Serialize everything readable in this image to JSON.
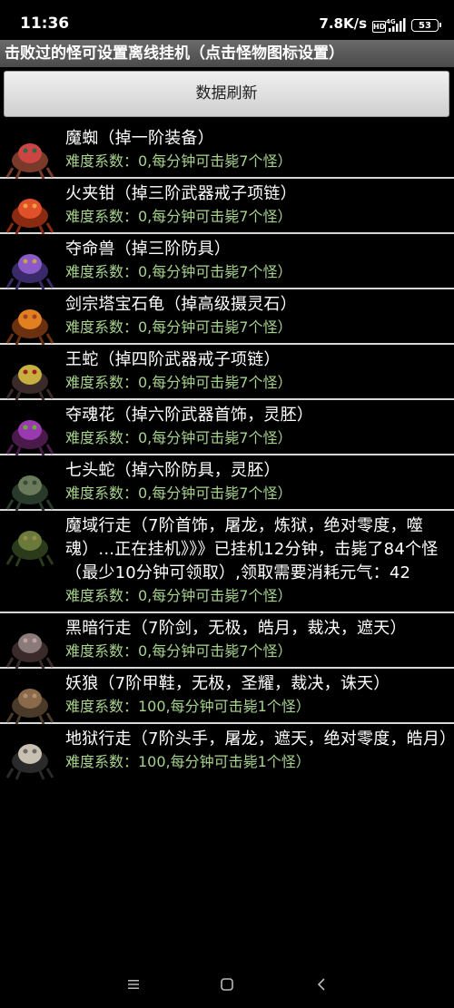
{
  "status": {
    "time": "11:36",
    "speed": "7.8K/s",
    "hd": "HD",
    "network": "4G",
    "battery": "53"
  },
  "title": "击败过的怪可设置离线挂机（点击怪物图标设置）",
  "refresh_label": "数据刷新",
  "monsters": [
    {
      "name": "魔蜘（掉一阶装备）",
      "difficulty": "难度系数：0,每分钟可击毙7个怪）",
      "icon": "spider-monster-icon"
    },
    {
      "name": "火夹钳（掉三阶武器戒子项链）",
      "difficulty": "难度系数：0,每分钟可击毙7个怪）",
      "icon": "fire-crab-icon"
    },
    {
      "name": "夺命兽（掉三阶防具）",
      "difficulty": "难度系数：0,每分钟可击毙7个怪）",
      "icon": "beast-monster-icon"
    },
    {
      "name": "剑宗塔宝石龟（掉高级摄灵石）",
      "difficulty": "难度系数：0,每分钟可击毙7个怪）",
      "icon": "gem-turtle-icon"
    },
    {
      "name": "王蛇（掉四阶武器戒子项链）",
      "difficulty": "难度系数：0,每分钟可击毙7个怪）",
      "icon": "king-snake-icon"
    },
    {
      "name": "夺魂花（掉六阶武器首饰，灵胚）",
      "difficulty": "难度系数：0,每分钟可击毙7个怪）",
      "icon": "soul-flower-icon"
    },
    {
      "name": "七头蛇（掉六阶防具，灵胚）",
      "difficulty": "难度系数：0,每分钟可击毙7个怪）",
      "icon": "hydra-icon"
    },
    {
      "name": "魔域行走（7阶首饰，屠龙，炼狱，绝对零度，噬魂）...正在挂机》》》已挂机12分钟，击毙了84个怪（最少10分钟可领取）,领取需要消耗元气：42",
      "difficulty": "难度系数：0,每分钟可击毙7个怪）",
      "icon": "demon-walker-icon"
    },
    {
      "name": "黑暗行走（7阶剑，无极，皓月，裁决，遮天）",
      "difficulty": "难度系数：0,每分钟可击毙7个怪）",
      "icon": "dark-walker-icon"
    },
    {
      "name": "妖狼（7阶甲鞋，无极，圣耀，裁决，诛天）",
      "difficulty": "难度系数：100,每分钟可击毙1个怪）",
      "icon": "demon-wolf-icon"
    },
    {
      "name": "地狱行走（7阶头手，屠龙，遮天，绝对零度，皓月）",
      "difficulty": "难度系数：100,每分钟可击毙1个怪）",
      "icon": "hell-walker-icon"
    }
  ],
  "nav": {
    "menu_icon": "menu-icon",
    "home_icon": "home-icon",
    "back_icon": "back-icon"
  },
  "colors": {
    "background": "#000000",
    "title_bar": "#555555",
    "difficulty_text": "#a7d28d",
    "separator": "#d8d8d8"
  }
}
